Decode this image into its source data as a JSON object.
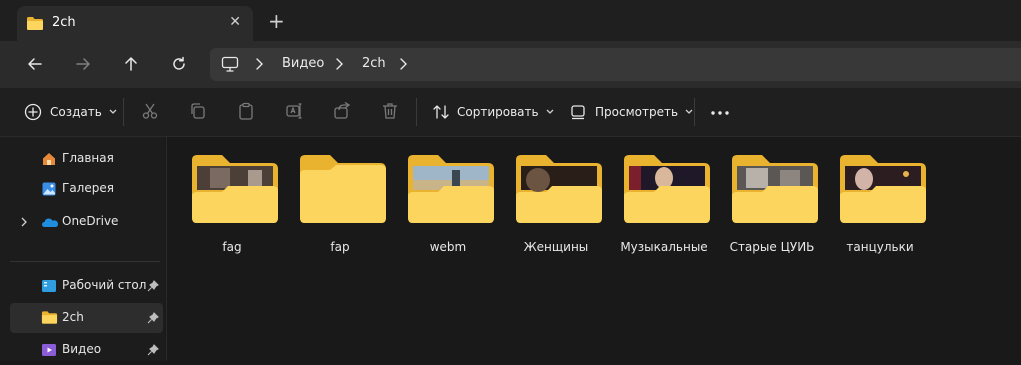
{
  "tab": {
    "title": "2ch",
    "close_glyph": "✕",
    "new_tab_glyph": "+"
  },
  "nav": {
    "back_icon": "arrow-left-icon",
    "forward_icon": "arrow-right-icon",
    "up_icon": "arrow-up-icon",
    "refresh_icon": "refresh-icon"
  },
  "breadcrumb": {
    "items": [
      "Видео",
      "2ch"
    ]
  },
  "commandbar": {
    "create": "Создать",
    "sort": "Сортировать",
    "view": "Просмотреть"
  },
  "sidebar": {
    "items": [
      {
        "label": "Главная",
        "icon": "home-icon"
      },
      {
        "label": "Галерея",
        "icon": "gallery-icon"
      },
      {
        "label": "OneDrive",
        "icon": "onedrive-icon"
      },
      {
        "label": "Рабочий стол",
        "icon": "desktop-icon",
        "pinned": true
      },
      {
        "label": "2ch",
        "icon": "folder-icon",
        "pinned": true,
        "selected": true
      },
      {
        "label": "Видео",
        "icon": "video-icon",
        "pinned": true
      }
    ]
  },
  "folders": [
    {
      "name": "fag",
      "thumb": "#4b3f38"
    },
    {
      "name": "fap",
      "thumb": null
    },
    {
      "name": "webm",
      "thumb": "#7d8fa0"
    },
    {
      "name": "Женщины",
      "thumb": "#3a2a1f"
    },
    {
      "name": "Музыкальные",
      "thumb": "#2c2434"
    },
    {
      "name": "Старые ЦУИЬ",
      "thumb": "#6f6a66"
    },
    {
      "name": "танцульки",
      "thumb": "#2f2124"
    }
  ],
  "colors": {
    "folder_back": "#e9b22f",
    "folder_front": "#fcd55e",
    "accent": "#4cc2ff"
  }
}
